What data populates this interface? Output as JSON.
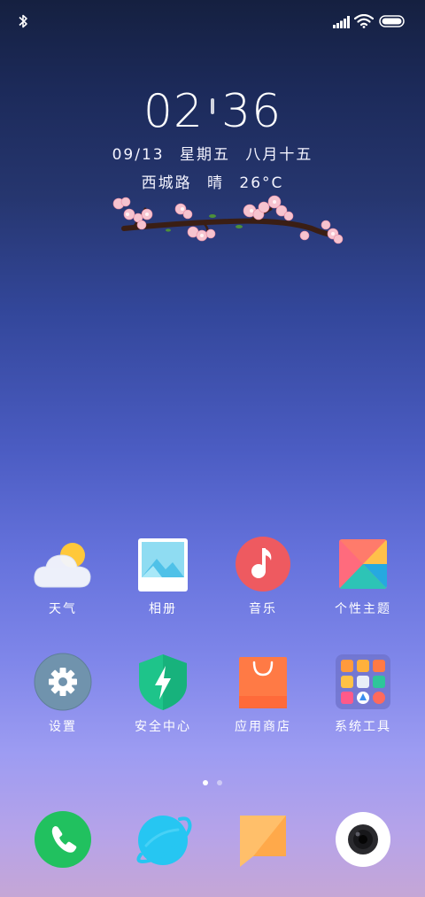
{
  "status_bar": {
    "left_icons": [
      "bluetooth-icon"
    ],
    "right_icons": [
      "cellular-signal-icon",
      "wifi-icon",
      "battery-icon"
    ]
  },
  "clock": {
    "hour": "02",
    "minute": "36",
    "date": "09/13",
    "weekday": "星期五",
    "lunar_date": "八月十五",
    "location": "西城路",
    "condition": "晴",
    "temperature": "26°C"
  },
  "home_screen": {
    "row1": [
      {
        "label": "天气",
        "icon": "weather-icon"
      },
      {
        "label": "相册",
        "icon": "gallery-icon"
      },
      {
        "label": "音乐",
        "icon": "music-icon"
      },
      {
        "label": "个性主题",
        "icon": "themes-icon"
      }
    ],
    "row2": [
      {
        "label": "设置",
        "icon": "settings-gear-icon"
      },
      {
        "label": "安全中心",
        "icon": "security-shield-icon"
      },
      {
        "label": "应用商店",
        "icon": "app-store-bag-icon"
      },
      {
        "label": "系统工具",
        "icon": "folder-icon"
      }
    ]
  },
  "page_indicator": {
    "pages": 2,
    "current": 1
  },
  "dock": [
    {
      "icon": "phone-icon",
      "color": "#21c15f"
    },
    {
      "icon": "browser-planet-icon",
      "color": "#26c6f2"
    },
    {
      "icon": "messages-icon",
      "color": "#ffb860"
    },
    {
      "icon": "camera-icon",
      "color": "#ffffff"
    }
  ],
  "colors": {
    "bg_top": "#152040",
    "bg_bottom": "#c5a6d6",
    "music_red": "#ee5a60",
    "security_green": "#1ec48a",
    "store_orange": "#ff7a45",
    "settings_gray": "#6f8fa9"
  }
}
